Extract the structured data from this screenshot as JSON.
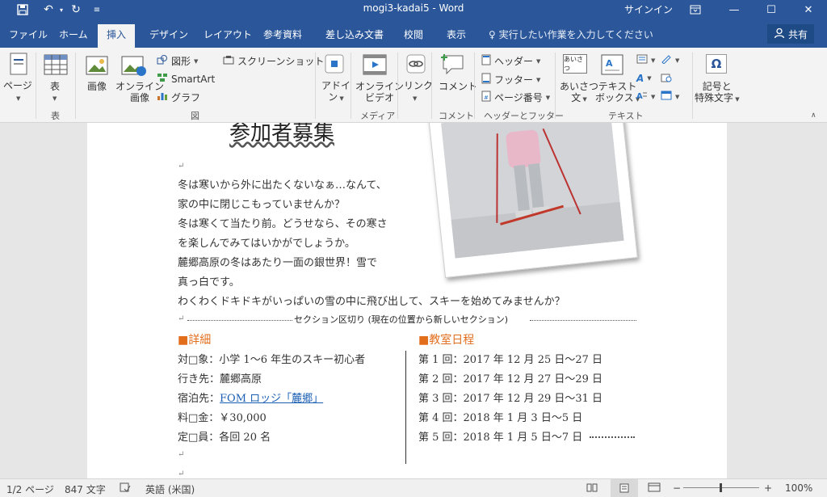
{
  "window": {
    "title": "mogi3-kadai5  -  Word",
    "signin": "サインイン",
    "minimize": "—",
    "maximize": "☐",
    "close": "✕"
  },
  "tabs": [
    "ファイル",
    "ホーム",
    "挿入",
    "デザイン",
    "レイアウト",
    "参考資料",
    "差し込み文書",
    "校閲",
    "表示"
  ],
  "active_tab": "挿入",
  "tellme": "実行したい作業を入力してください",
  "share": "共有",
  "ribbon": {
    "page": "ページ",
    "table": "表",
    "table_group": "表",
    "picture": "画像",
    "online_picture": [
      "オンライン",
      "画像"
    ],
    "shapes": "図形",
    "screenshot": "スクリーンショット",
    "smartart": "SmartArt",
    "chart": "グラフ",
    "illustrations_group": "図",
    "addin": [
      "アドイ",
      "ン"
    ],
    "online_video": [
      "オンライン",
      "ビデオ"
    ],
    "media_group": "メディア",
    "link": "リンク",
    "comment": "コメント",
    "comment_group": "コメント",
    "header": "ヘッダー",
    "footer": "フッター",
    "page_number": "ページ番号",
    "header_footer_group": "ヘッダーとフッター",
    "greeting": [
      "あいさつ",
      "文"
    ],
    "greeting_icon": "あいさつ",
    "textbox": [
      "テキスト",
      "ボックス"
    ],
    "text_group": "テキスト",
    "symbol": [
      "記号と",
      "特殊文字"
    ]
  },
  "document": {
    "title_partial": "参加者募集",
    "body_lines": [
      "冬は寒いから外に出たくないなぁ…なんて、",
      "家の中に閉じこもっていませんか？",
      "冬は寒くて当たり前。どうせなら、その寒さ",
      "を楽しんでみてはいかがでしょうか。",
      "麓郷高原の冬はあたり一面の銀世界！雪で",
      "真っ白です。",
      "わくわくドキドキがいっぱいの雪の中に飛び出して、スキーを始めてみませんか？"
    ],
    "section_break": "セクション区切り (現在の位置から新しいセクション)",
    "details_heading": "■詳細",
    "details": [
      {
        "label": "対□象：",
        "value": "小学 1～6 年生のスキー初心者"
      },
      {
        "label": "行き先：",
        "value": "麓郷高原"
      },
      {
        "label": "宿泊先：",
        "value": "FOM ロッジ「麓郷」"
      },
      {
        "label": "料□金：",
        "value": "￥30,000"
      },
      {
        "label": "定□員：",
        "value": "各回 20 名"
      }
    ],
    "schedule_heading": "■教室日程",
    "schedule": [
      "第 1 回：2017 年 12 月 25 日～27 日",
      "第 2 回：2017 年 12 月 27 日～29 日",
      "第 3 回：2017 年 12 月 29 日～31 日",
      "第 4 回：2018 年 1 月 3 日～5 日",
      "第 5 回：2018 年 1 月 5 日～7 日"
    ]
  },
  "status": {
    "page": "1/2 ページ",
    "words": "847 文字",
    "language": "英語 (米国)",
    "zoom": "100%"
  },
  "colors": {
    "brand": "#2b579a",
    "orange_heading": "#e26e1c",
    "link": "#1a5fb4"
  }
}
